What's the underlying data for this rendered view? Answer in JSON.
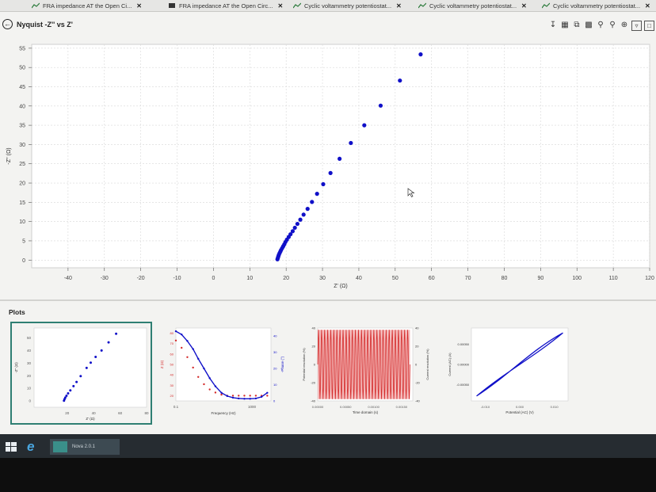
{
  "tabs": [
    {
      "label": "FRA impedance AT the Open Ci...",
      "close": "✕"
    },
    {
      "label": "FRA impedance AT the Open Circ...",
      "close": "✕"
    },
    {
      "label": "Cyclic voltammetry potentiostat...",
      "close": "✕"
    },
    {
      "label": "Cyclic voltammetry potentiostat...",
      "close": "✕"
    },
    {
      "label": "Cyclic voltammetry potentiostat...",
      "close": "✕"
    }
  ],
  "header": {
    "back_icon": "back-arrow-icon",
    "title": "Nyquist -Z'' vs Z'"
  },
  "toolbar": {
    "icons": [
      "pin-icon",
      "table-icon",
      "copy-icon",
      "print-icon",
      "zoom-out-icon",
      "zoom-fit-icon",
      "zoom-in-icon",
      "filter-icon",
      "window-icon"
    ]
  },
  "plots_section": {
    "label": "Plots"
  },
  "colors": {
    "series_blue": "#1010c8",
    "series_red": "#d42a2a",
    "selected_border": "#2f7f73",
    "grid": "#d8d8d8"
  },
  "taskbar": {
    "app_label": "Nova 2.0.1"
  },
  "chart_data": [
    {
      "type": "scatter",
      "title": "Nyquist -Z'' vs Z'",
      "xlabel": "Z' (Ω)",
      "ylabel": "-Z'' (Ω)",
      "xlim": [
        -50,
        120
      ],
      "ylim": [
        -2,
        56
      ],
      "xticks": [
        -40,
        -30,
        -20,
        -10,
        0,
        10,
        20,
        30,
        40,
        50,
        60,
        70,
        80,
        90,
        100,
        110,
        120
      ],
      "yticks": [
        0,
        5,
        10,
        15,
        20,
        25,
        30,
        35,
        40,
        45,
        50,
        55
      ],
      "grid": true,
      "series": [
        {
          "x": [
            17.6,
            17.7,
            17.8,
            17.9,
            18.0,
            18.2,
            18.4,
            18.6,
            18.9,
            19.2,
            19.5,
            19.8,
            20.2,
            20.7,
            21.2,
            21.8,
            22.4,
            23.1,
            23.9,
            24.8,
            25.9,
            27.1,
            28.5,
            30.2,
            32.2,
            34.7,
            37.8,
            41.5,
            46.0,
            51.3,
            57.0
          ],
          "y": [
            0.2,
            0.5,
            0.8,
            1.1,
            1.4,
            1.8,
            2.2,
            2.6,
            3.1,
            3.6,
            4.1,
            4.7,
            5.3,
            6.0,
            6.7,
            7.5,
            8.4,
            9.4,
            10.5,
            11.8,
            13.3,
            15.1,
            17.2,
            19.7,
            22.6,
            26.3,
            30.4,
            35.0,
            40.1,
            46.6,
            53.4
          ]
        }
      ]
    },
    {
      "type": "scatter",
      "title": "",
      "xlabel": "Z' (Ω)",
      "ylabel": "-Z'' (Ω)",
      "xlim": [
        -5,
        80
      ],
      "ylim": [
        -5,
        58
      ],
      "xticks": [
        20,
        40,
        60,
        80
      ],
      "yticks": [
        0,
        10,
        20,
        30,
        40,
        50
      ],
      "series": [
        {
          "x": [
            17.6,
            18.0,
            18.6,
            19.5,
            20.7,
            22.4,
            24.8,
            27.1,
            30.2,
            34.7,
            37.8,
            41.5,
            46.0,
            51.3,
            57.0
          ],
          "y": [
            0.2,
            1.4,
            2.6,
            4.1,
            6.0,
            8.4,
            11.8,
            15.1,
            19.7,
            26.3,
            30.4,
            35.0,
            40.1,
            46.6,
            53.4
          ]
        }
      ]
    },
    {
      "type": "scatter",
      "title": "",
      "xlabel": "Frequency (Hz)",
      "ylabel": "Z (Ω)",
      "ylabel_right": "-Phase (°)",
      "xlim": [
        0.1,
        10000
      ],
      "log_x": true,
      "xticks": [
        0.1,
        1000
      ],
      "yticks_left": [
        20,
        30,
        40,
        50,
        60,
        70,
        80
      ],
      "yticks_right": [
        0,
        10,
        20,
        30,
        40
      ],
      "series": [
        {
          "name": "",
          "color": "#1010c8",
          "x": [
            0.1,
            0.2,
            0.4,
            0.8,
            1.5,
            3,
            6,
            12,
            25,
            50,
            100,
            200,
            400,
            800,
            1600,
            3200,
            6400
          ],
          "y": [
            43,
            41,
            37,
            32,
            26,
            20,
            14,
            9,
            5,
            3,
            2,
            1.5,
            1.3,
            1.3,
            1.5,
            2.5,
            5
          ]
        },
        {
          "name": "",
          "color": "#d42a2a",
          "x": [
            0.1,
            0.2,
            0.4,
            0.8,
            1.5,
            3,
            6,
            12,
            25,
            50,
            100,
            200,
            400,
            800,
            1600,
            3200,
            6400
          ],
          "y": [
            73,
            66,
            57,
            47,
            38,
            31,
            26,
            23,
            21,
            20,
            20,
            20,
            20,
            20,
            20,
            20,
            20
          ]
        }
      ]
    },
    {
      "type": "line",
      "title": "",
      "xlabel": "Time domain (s)",
      "ylabel": "Potential resolution (%)",
      "ylabel_right": "Current resolution (%)",
      "xticks": [
        0.0,
        0.0005,
        0.001,
        0.0015
      ],
      "xtick_labels": [
        "0.00000",
        "0.00050",
        "0.00100",
        "0.00150"
      ],
      "yticks_left": [
        -40,
        -20,
        0,
        20,
        40
      ],
      "yticks_right": [
        -40,
        -20,
        0,
        20,
        40
      ],
      "xlim": [
        0,
        0.0017
      ],
      "ylim": [
        -40,
        40
      ],
      "series": [
        {
          "name": "",
          "color": "#d42a2a",
          "amplitude": 38,
          "cycles": 30
        }
      ]
    },
    {
      "type": "line",
      "title": "",
      "xlabel": "Potential (AC) (V)",
      "ylabel": "Current (AC) (A)",
      "xticks": [
        -0.01,
        0.0,
        0.01
      ],
      "xtick_labels": [
        "-0.010",
        "0.000",
        "0.010"
      ],
      "yticks": [
        -0.0005,
        0.0,
        0.0005
      ],
      "ytick_labels": [
        "-0.00050",
        "0.00000",
        "0.00050"
      ],
      "xlim": [
        -0.014,
        0.014
      ],
      "ylim": [
        -0.0009,
        0.0009
      ],
      "series": [
        {
          "name": "",
          "color": "#1010c8",
          "type": "lissajous",
          "x": [
            -0.0125,
            0.0125
          ],
          "y": [
            -0.00078,
            0.00078
          ]
        }
      ]
    }
  ]
}
